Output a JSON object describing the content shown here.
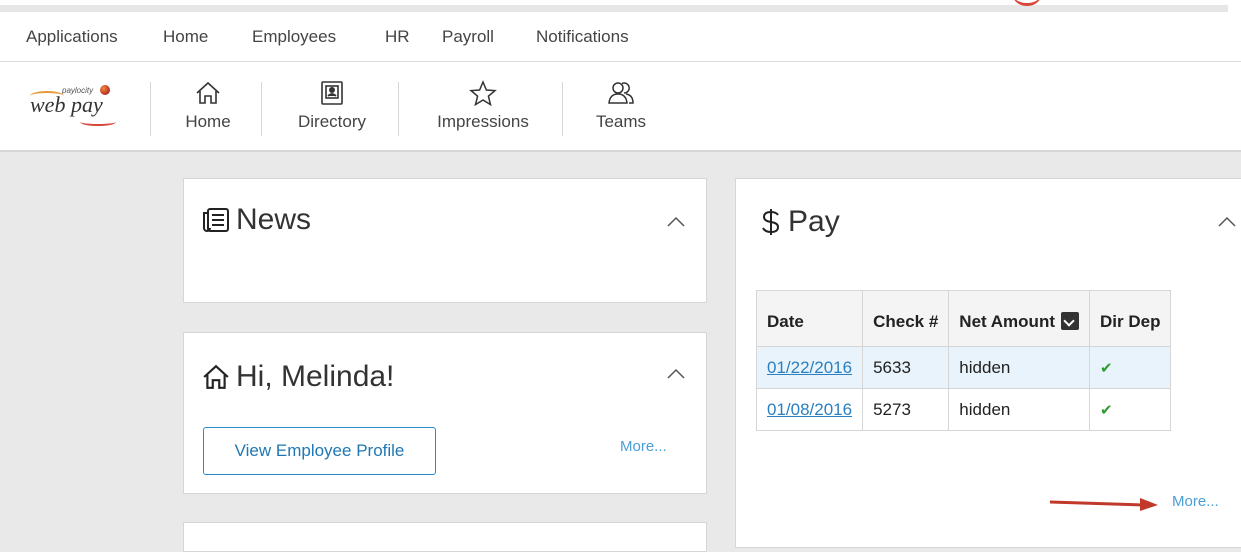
{
  "menu": {
    "items": [
      {
        "label": "Applications"
      },
      {
        "label": "Home"
      },
      {
        "label": "Employees"
      },
      {
        "label": "HR"
      },
      {
        "label": "Payroll"
      },
      {
        "label": "Notifications"
      }
    ]
  },
  "logo": {
    "small": "paylocity",
    "brand": "web pay"
  },
  "toolbar": {
    "items": [
      {
        "label": "Home",
        "icon": "home-icon"
      },
      {
        "label": "Directory",
        "icon": "contact-card-icon"
      },
      {
        "label": "Impressions",
        "icon": "star-icon"
      },
      {
        "label": "Teams",
        "icon": "people-icon"
      }
    ]
  },
  "news": {
    "title": "News",
    "icon": "newspaper-icon"
  },
  "greeting": {
    "title": "Hi, Melinda!",
    "icon": "home-icon",
    "button": "View Employee Profile",
    "more": "More..."
  },
  "pay": {
    "title": "Pay",
    "icon": "dollar-icon",
    "columns": [
      "Date",
      "Check #",
      "Net Amount",
      "Dir Dep"
    ],
    "rows": [
      {
        "date": "01/22/2016",
        "check": "5633",
        "amount": "hidden",
        "dirdep": "✔"
      },
      {
        "date": "01/08/2016",
        "check": "5273",
        "amount": "hidden",
        "dirdep": "✔"
      }
    ],
    "more": "More..."
  },
  "colors": {
    "accent": "#2a8bc9",
    "link": "#2a80c0",
    "check": "#2e9b2e",
    "arrow": "#c0392b",
    "highlight_row": "#e8f3fb"
  }
}
